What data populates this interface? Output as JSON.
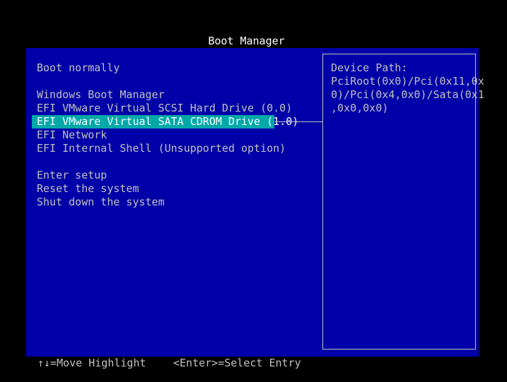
{
  "title": "Boot Manager",
  "menu": {
    "boot_normally": "Boot normally",
    "boot_entries": [
      "Windows Boot Manager",
      "EFI VMware Virtual SCSI Hard Drive (0.0)",
      "EFI VMware Virtual SATA CDROM Drive (1.0)",
      "EFI Network",
      "EFI Internal Shell (Unsupported option)"
    ],
    "selected_entry": "EFI VMware Virtual SATA CDROM Drive (1.0)",
    "actions": [
      "Enter setup",
      "Reset the system",
      "Shut down the system"
    ]
  },
  "help": {
    "label": "Device Path:",
    "lines": [
      "PciRoot(0x0)/Pci(0x11,0x",
      "0)/Pci(0x4,0x0)/Sata(0x1",
      ",0x0,0x0)"
    ]
  },
  "footer": {
    "move_hint": "↑↓=Move Highlight",
    "select_hint": "<Enter>=Select Entry"
  },
  "colors": {
    "background": "#000000",
    "panel": "#0000a8",
    "highlight": "#00a8a8",
    "text": "#c0c0c0",
    "title": "#ffffff"
  }
}
